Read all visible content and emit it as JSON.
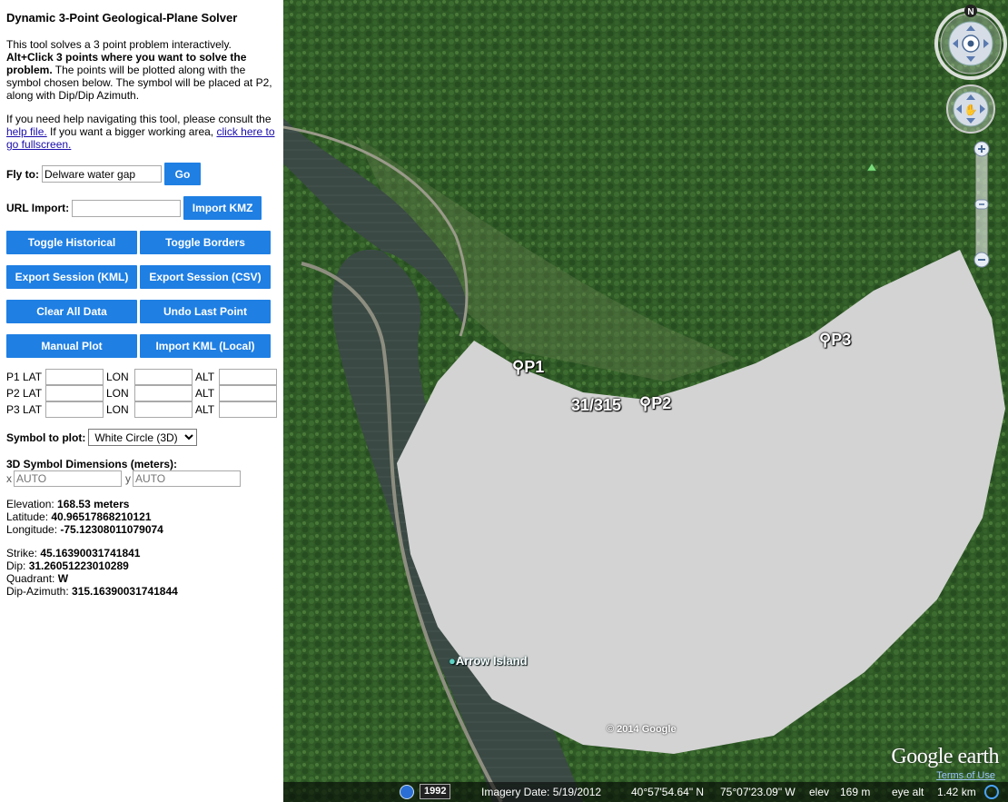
{
  "panel": {
    "title": "Dynamic 3-Point Geological-Plane Solver",
    "intro_1": "This tool solves a 3 point problem interactively.",
    "intro_bold": "Alt+Click 3 points where you want to solve the problem.",
    "intro_2": " The points will be plotted along with the symbol chosen below. The symbol will be placed at P2, along with Dip/Dip Azimuth.",
    "help_1": "If you need help navigating this tool, please consult the ",
    "help_link": "help file.",
    "help_2": " If you want a bigger working area, ",
    "fullscreen_link": "click here to go fullscreen.",
    "fly_to_label": "Fly to:",
    "fly_to_value": "Delware water gap",
    "go_label": "Go",
    "url_import_label": "URL Import:",
    "url_import_value": "",
    "import_kmz_label": "Import KMZ",
    "buttons": {
      "toggle_historical": "Toggle Historical",
      "toggle_borders": "Toggle Borders",
      "export_kml": "Export Session (KML)",
      "export_csv": "Export Session (CSV)",
      "clear_all": "Clear All Data",
      "undo_last": "Undo Last Point",
      "manual_plot": "Manual Plot",
      "import_kml_local": "Import KML (Local)"
    },
    "coord_rows": [
      {
        "point": "P1 LAT",
        "lon": "LON",
        "alt": "ALT"
      },
      {
        "point": "P2 LAT",
        "lon": "LON",
        "alt": "ALT"
      },
      {
        "point": "P3 LAT",
        "lon": "LON",
        "alt": "ALT"
      }
    ],
    "symbol_label": "Symbol to plot:",
    "symbol_selected": "White Circle (3D)",
    "dims_title": "3D Symbol Dimensions (meters):",
    "dim_x_label": "x",
    "dim_x_placeholder": "AUTO",
    "dim_y_label": "y",
    "dim_y_placeholder": "AUTO",
    "elevation_label": "Elevation: ",
    "elevation_value": "168.53 meters",
    "latitude_label": "Latitude: ",
    "latitude_value": "40.96517868210121",
    "longitude_label": "Longitude: ",
    "longitude_value": "-75.12308011079074",
    "strike_label": "Strike: ",
    "strike_value": "45.16390031741841",
    "dip_label": "Dip: ",
    "dip_value": "31.26051223010289",
    "quadrant_label": "Quadrant: ",
    "quadrant_value": "W",
    "dip_azimuth_label": "Dip-Azimuth: ",
    "dip_azimuth_value": "315.16390031741844"
  },
  "map": {
    "points": [
      "P1",
      "P2",
      "P3"
    ],
    "dip_label": "31/315",
    "place_label": "Arrow Island",
    "copyright": "© 2014 Google",
    "brand": "Google earth",
    "terms": "Terms of Use",
    "compass_letter": "N",
    "year_badge": "1992",
    "imagery_date": "Imagery Date: 5/19/2012",
    "lat_readout": "40°57'54.64\" N",
    "lon_readout": "75°07'23.09\" W",
    "elev_label": "elev",
    "elev_value": "169 m",
    "eye_alt_label": "eye alt",
    "eye_alt_value": "1.42 km",
    "colors": {
      "forest": "#2f5a26",
      "river": "#3b4a44",
      "plane": "#d3d3d3",
      "button": "#1f7fe3"
    }
  }
}
